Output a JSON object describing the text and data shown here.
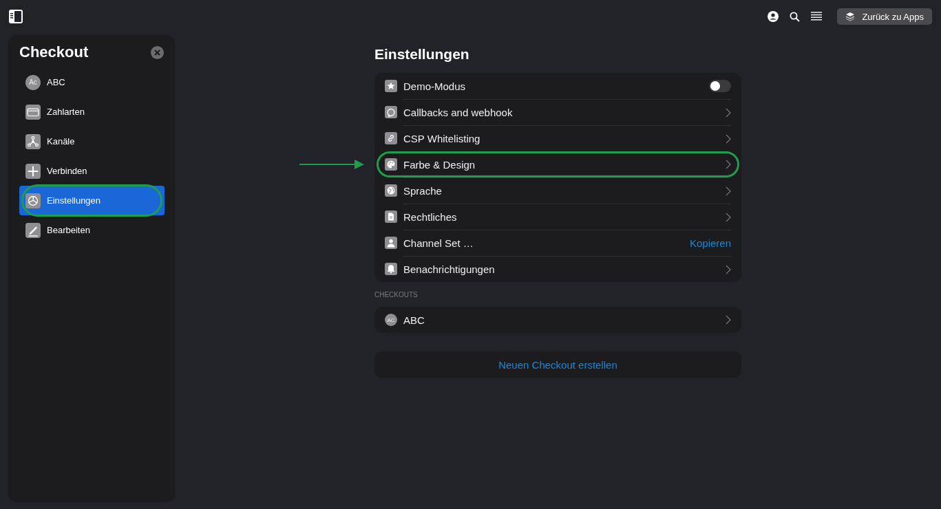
{
  "topbar": {
    "back_button": "Zurück zu Apps"
  },
  "sidebar": {
    "title": "Checkout",
    "items": [
      {
        "label": "ABC",
        "avatar_text": "Ac",
        "selected": false,
        "highlighted": false
      },
      {
        "label": "Zahlarten",
        "selected": false,
        "highlighted": false
      },
      {
        "label": "Kanäle",
        "selected": false,
        "highlighted": false
      },
      {
        "label": "Verbinden",
        "selected": false,
        "highlighted": false
      },
      {
        "label": "Einstellungen",
        "selected": true,
        "highlighted": true
      },
      {
        "label": "Bearbeiten",
        "selected": false,
        "highlighted": false
      }
    ]
  },
  "settings": {
    "title": "Einstellungen",
    "rows": [
      {
        "kind": "toggle",
        "label": "Demo-Modus",
        "on": false,
        "highlighted": false
      },
      {
        "kind": "link",
        "label": "Callbacks and webhook",
        "highlighted": false
      },
      {
        "kind": "link",
        "label": "CSP Whitelisting",
        "highlighted": false
      },
      {
        "kind": "link",
        "label": "Farbe & Design",
        "highlighted": true
      },
      {
        "kind": "link",
        "label": "Sprache",
        "highlighted": false
      },
      {
        "kind": "link",
        "label": "Rechtliches",
        "highlighted": false
      },
      {
        "kind": "action",
        "label": "Channel Set …",
        "action": "Kopieren",
        "highlighted": false
      },
      {
        "kind": "link",
        "label": "Benachrichtigungen",
        "highlighted": false
      }
    ],
    "section_label": "CHECKOUTS",
    "checkouts": [
      {
        "label": "ABC",
        "avatar_text": "AC"
      }
    ],
    "create_button": "Neuen Checkout erstellen"
  }
}
